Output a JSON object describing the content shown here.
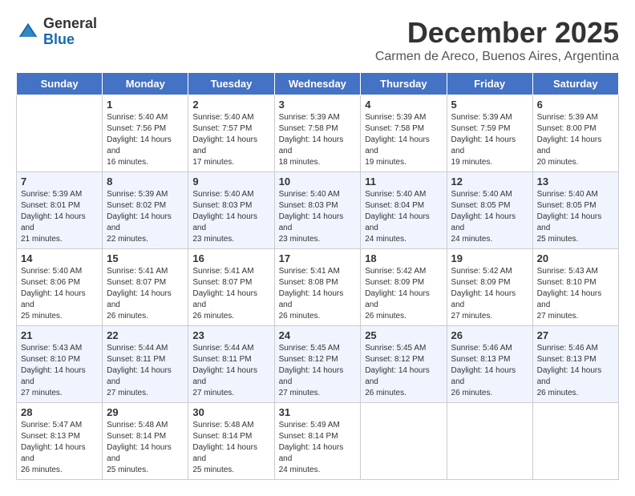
{
  "logo": {
    "general": "General",
    "blue": "Blue"
  },
  "title": "December 2025",
  "subtitle": "Carmen de Areco, Buenos Aires, Argentina",
  "days": [
    "Sunday",
    "Monday",
    "Tuesday",
    "Wednesday",
    "Thursday",
    "Friday",
    "Saturday"
  ],
  "weeks": [
    [
      {
        "num": "",
        "rise": "",
        "set": "",
        "daylight": ""
      },
      {
        "num": "1",
        "rise": "Sunrise: 5:40 AM",
        "set": "Sunset: 7:56 PM",
        "daylight": "Daylight: 14 hours and 16 minutes."
      },
      {
        "num": "2",
        "rise": "Sunrise: 5:40 AM",
        "set": "Sunset: 7:57 PM",
        "daylight": "Daylight: 14 hours and 17 minutes."
      },
      {
        "num": "3",
        "rise": "Sunrise: 5:39 AM",
        "set": "Sunset: 7:58 PM",
        "daylight": "Daylight: 14 hours and 18 minutes."
      },
      {
        "num": "4",
        "rise": "Sunrise: 5:39 AM",
        "set": "Sunset: 7:58 PM",
        "daylight": "Daylight: 14 hours and 19 minutes."
      },
      {
        "num": "5",
        "rise": "Sunrise: 5:39 AM",
        "set": "Sunset: 7:59 PM",
        "daylight": "Daylight: 14 hours and 19 minutes."
      },
      {
        "num": "6",
        "rise": "Sunrise: 5:39 AM",
        "set": "Sunset: 8:00 PM",
        "daylight": "Daylight: 14 hours and 20 minutes."
      }
    ],
    [
      {
        "num": "7",
        "rise": "Sunrise: 5:39 AM",
        "set": "Sunset: 8:01 PM",
        "daylight": "Daylight: 14 hours and 21 minutes."
      },
      {
        "num": "8",
        "rise": "Sunrise: 5:39 AM",
        "set": "Sunset: 8:02 PM",
        "daylight": "Daylight: 14 hours and 22 minutes."
      },
      {
        "num": "9",
        "rise": "Sunrise: 5:40 AM",
        "set": "Sunset: 8:03 PM",
        "daylight": "Daylight: 14 hours and 23 minutes."
      },
      {
        "num": "10",
        "rise": "Sunrise: 5:40 AM",
        "set": "Sunset: 8:03 PM",
        "daylight": "Daylight: 14 hours and 23 minutes."
      },
      {
        "num": "11",
        "rise": "Sunrise: 5:40 AM",
        "set": "Sunset: 8:04 PM",
        "daylight": "Daylight: 14 hours and 24 minutes."
      },
      {
        "num": "12",
        "rise": "Sunrise: 5:40 AM",
        "set": "Sunset: 8:05 PM",
        "daylight": "Daylight: 14 hours and 24 minutes."
      },
      {
        "num": "13",
        "rise": "Sunrise: 5:40 AM",
        "set": "Sunset: 8:05 PM",
        "daylight": "Daylight: 14 hours and 25 minutes."
      }
    ],
    [
      {
        "num": "14",
        "rise": "Sunrise: 5:40 AM",
        "set": "Sunset: 8:06 PM",
        "daylight": "Daylight: 14 hours and 25 minutes."
      },
      {
        "num": "15",
        "rise": "Sunrise: 5:41 AM",
        "set": "Sunset: 8:07 PM",
        "daylight": "Daylight: 14 hours and 26 minutes."
      },
      {
        "num": "16",
        "rise": "Sunrise: 5:41 AM",
        "set": "Sunset: 8:07 PM",
        "daylight": "Daylight: 14 hours and 26 minutes."
      },
      {
        "num": "17",
        "rise": "Sunrise: 5:41 AM",
        "set": "Sunset: 8:08 PM",
        "daylight": "Daylight: 14 hours and 26 minutes."
      },
      {
        "num": "18",
        "rise": "Sunrise: 5:42 AM",
        "set": "Sunset: 8:09 PM",
        "daylight": "Daylight: 14 hours and 26 minutes."
      },
      {
        "num": "19",
        "rise": "Sunrise: 5:42 AM",
        "set": "Sunset: 8:09 PM",
        "daylight": "Daylight: 14 hours and 27 minutes."
      },
      {
        "num": "20",
        "rise": "Sunrise: 5:43 AM",
        "set": "Sunset: 8:10 PM",
        "daylight": "Daylight: 14 hours and 27 minutes."
      }
    ],
    [
      {
        "num": "21",
        "rise": "Sunrise: 5:43 AM",
        "set": "Sunset: 8:10 PM",
        "daylight": "Daylight: 14 hours and 27 minutes."
      },
      {
        "num": "22",
        "rise": "Sunrise: 5:44 AM",
        "set": "Sunset: 8:11 PM",
        "daylight": "Daylight: 14 hours and 27 minutes."
      },
      {
        "num": "23",
        "rise": "Sunrise: 5:44 AM",
        "set": "Sunset: 8:11 PM",
        "daylight": "Daylight: 14 hours and 27 minutes."
      },
      {
        "num": "24",
        "rise": "Sunrise: 5:45 AM",
        "set": "Sunset: 8:12 PM",
        "daylight": "Daylight: 14 hours and 27 minutes."
      },
      {
        "num": "25",
        "rise": "Sunrise: 5:45 AM",
        "set": "Sunset: 8:12 PM",
        "daylight": "Daylight: 14 hours and 26 minutes."
      },
      {
        "num": "26",
        "rise": "Sunrise: 5:46 AM",
        "set": "Sunset: 8:13 PM",
        "daylight": "Daylight: 14 hours and 26 minutes."
      },
      {
        "num": "27",
        "rise": "Sunrise: 5:46 AM",
        "set": "Sunset: 8:13 PM",
        "daylight": "Daylight: 14 hours and 26 minutes."
      }
    ],
    [
      {
        "num": "28",
        "rise": "Sunrise: 5:47 AM",
        "set": "Sunset: 8:13 PM",
        "daylight": "Daylight: 14 hours and 26 minutes."
      },
      {
        "num": "29",
        "rise": "Sunrise: 5:48 AM",
        "set": "Sunset: 8:14 PM",
        "daylight": "Daylight: 14 hours and 25 minutes."
      },
      {
        "num": "30",
        "rise": "Sunrise: 5:48 AM",
        "set": "Sunset: 8:14 PM",
        "daylight": "Daylight: 14 hours and 25 minutes."
      },
      {
        "num": "31",
        "rise": "Sunrise: 5:49 AM",
        "set": "Sunset: 8:14 PM",
        "daylight": "Daylight: 14 hours and 24 minutes."
      },
      {
        "num": "",
        "rise": "",
        "set": "",
        "daylight": ""
      },
      {
        "num": "",
        "rise": "",
        "set": "",
        "daylight": ""
      },
      {
        "num": "",
        "rise": "",
        "set": "",
        "daylight": ""
      }
    ]
  ]
}
